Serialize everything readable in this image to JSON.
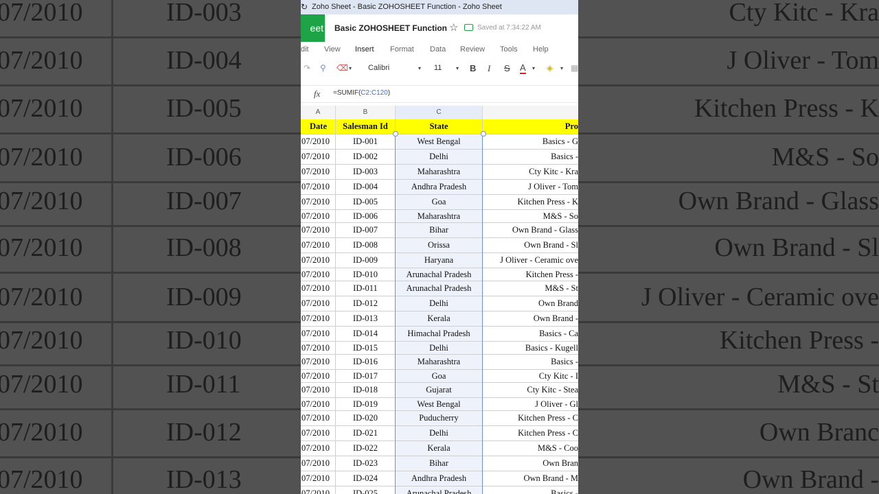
{
  "window": {
    "title": "Zoho Sheet - Basic ZOHOSHEET Function - Zoho Sheet"
  },
  "app": {
    "logo_text": "eet",
    "doc_name": "Basic ZOHOSHEET Function",
    "saved_status": "Saved at 7:34:22 AM"
  },
  "menu": [
    "dit",
    "View",
    "Insert",
    "Format",
    "Data",
    "Review",
    "Tools",
    "Help"
  ],
  "toolbar": {
    "font": "Calibri",
    "size": "11",
    "bold": "B",
    "italic": "I",
    "strike": "S",
    "fontcolor": "A"
  },
  "formula": {
    "prefix": "=SUMIF(",
    "ref": "C2:C120",
    "suffix": ")"
  },
  "columns": [
    "A",
    "B",
    "C"
  ],
  "headers": [
    "Date",
    "Salesman Id",
    "State",
    "Pro"
  ],
  "rows": [
    [
      "07/2010",
      "ID-001",
      "West Bengal",
      "Basics - G"
    ],
    [
      "07/2010",
      "ID-002",
      "Delhi",
      "Basics -"
    ],
    [
      "07/2010",
      "ID-003",
      "Maharashtra",
      "Cty Kitc - Kra"
    ],
    [
      "07/2010",
      "ID-004",
      "Andhra Pradesh",
      "J Oliver - Tom"
    ],
    [
      "07/2010",
      "ID-005",
      "Goa",
      "Kitchen Press - K"
    ],
    [
      "07/2010",
      "ID-006",
      "Maharashtra",
      "M&S - So"
    ],
    [
      "07/2010",
      "ID-007",
      "Bihar",
      "Own Brand - Glass"
    ],
    [
      "07/2010",
      "ID-008",
      "Orissa",
      "Own Brand - Sl"
    ],
    [
      "07/2010",
      "ID-009",
      "Haryana",
      "J Oliver - Ceramic ove"
    ],
    [
      "07/2010",
      "ID-010",
      "Arunachal Pradesh",
      "Kitchen Press -"
    ],
    [
      "07/2010",
      "ID-011",
      "Arunachal Pradesh",
      "M&S - St"
    ],
    [
      "07/2010",
      "ID-012",
      "Delhi",
      "Own Brand"
    ],
    [
      "07/2010",
      "ID-013",
      "Kerala",
      "Own Brand -"
    ],
    [
      "07/2010",
      "ID-014",
      "Himachal Pradesh",
      "Basics - Ca"
    ],
    [
      "07/2010",
      "ID-015",
      "Delhi",
      "Basics - Kugell"
    ],
    [
      "07/2010",
      "ID-016",
      "Maharashtra",
      "Basics -"
    ],
    [
      "07/2010",
      "ID-017",
      "Goa",
      "Cty Kitc - I"
    ],
    [
      "07/2010",
      "ID-018",
      "Gujarat",
      "Cty Kitc - Stea"
    ],
    [
      "07/2010",
      "ID-019",
      "West Bengal",
      "J Oliver - Gl"
    ],
    [
      "07/2010",
      "ID-020",
      "Puducherry",
      "Kitchen Press - C"
    ],
    [
      "07/2010",
      "ID-021",
      "Delhi",
      "Kitchen Press - C"
    ],
    [
      "07/2010",
      "ID-022",
      "Kerala",
      "M&S - Coo"
    ],
    [
      "07/2010",
      "ID-023",
      "Bihar",
      "Own Bran"
    ],
    [
      "07/2010",
      "ID-024",
      "Andhra Pradesh",
      "Own Brand - M"
    ],
    [
      "07/2010",
      "ID-025",
      "Arunachal Pradesh",
      "Basics -"
    ]
  ],
  "bg_left": [
    [
      "07/2010",
      "ID-003"
    ],
    [
      "07/2010",
      "ID-004"
    ],
    [
      "07/2010",
      "ID-005"
    ],
    [
      "07/2010",
      "ID-006"
    ],
    [
      "07/2010",
      "ID-007"
    ],
    [
      "07/2010",
      "ID-008"
    ],
    [
      "07/2010",
      "ID-009"
    ],
    [
      "07/2010",
      "ID-010"
    ],
    [
      "07/2010",
      "ID-011"
    ],
    [
      "07/2010",
      "ID-012"
    ],
    [
      "07/2010",
      "ID-013"
    ]
  ],
  "bg_right": [
    "Cty Kitc - Kra",
    "J Oliver - Tom",
    "Kitchen Press - K",
    "M&S - So",
    "Own Brand - Glass",
    "Own Brand - Sl",
    "J Oliver - Ceramic ove",
    "Kitchen Press -",
    "M&S - St",
    "Own Branc",
    "Own Brand -"
  ]
}
